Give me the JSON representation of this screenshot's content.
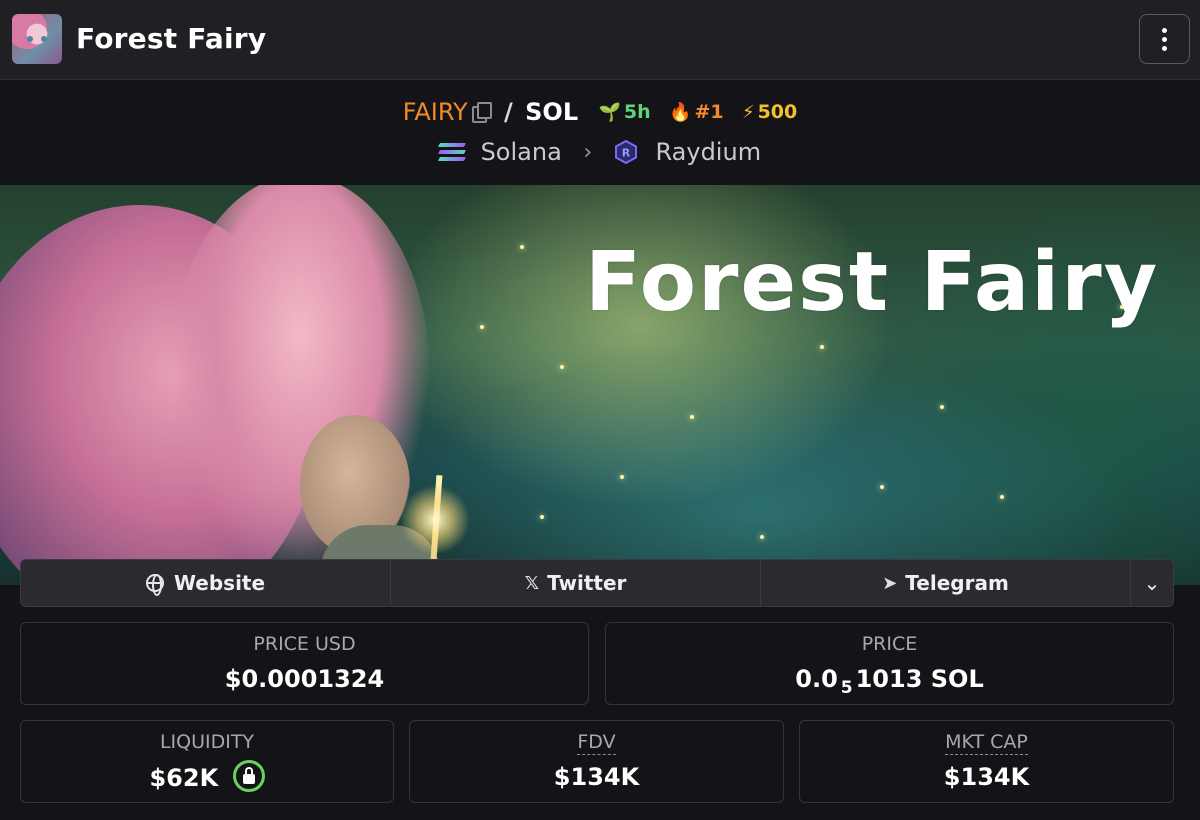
{
  "header": {
    "title": "Forest Fairy",
    "menu_icon": "kebab-menu-icon"
  },
  "pair": {
    "base_symbol": "FAIRY",
    "separator": "/",
    "quote_symbol": "SOL",
    "age": "5h",
    "rank": "#1",
    "boosts": "500",
    "colors": {
      "base": "#f28a2b",
      "age": "#5fd27a",
      "rank": "#f28a2b",
      "boosts": "#f2c12b"
    }
  },
  "chain": {
    "name": "Solana",
    "dex": "Raydium"
  },
  "banner": {
    "title": "Forest Fairy"
  },
  "links": [
    {
      "label": "Website",
      "icon": "globe-icon"
    },
    {
      "label": "Twitter",
      "icon": "x-logo-icon"
    },
    {
      "label": "Telegram",
      "icon": "telegram-plane-icon"
    }
  ],
  "stats": {
    "price_usd": {
      "label": "PRICE USD",
      "value": "$0.0001324"
    },
    "price_native": {
      "label": "PRICE",
      "prefix": "0.0",
      "zeros": "5",
      "suffix": "1013 SOL"
    },
    "liquidity": {
      "label": "LIQUIDITY",
      "value": "$62K"
    },
    "fdv": {
      "label": "FDV",
      "value": "$134K"
    },
    "mkt_cap": {
      "label": "MKT CAP",
      "value": "$134K"
    }
  }
}
